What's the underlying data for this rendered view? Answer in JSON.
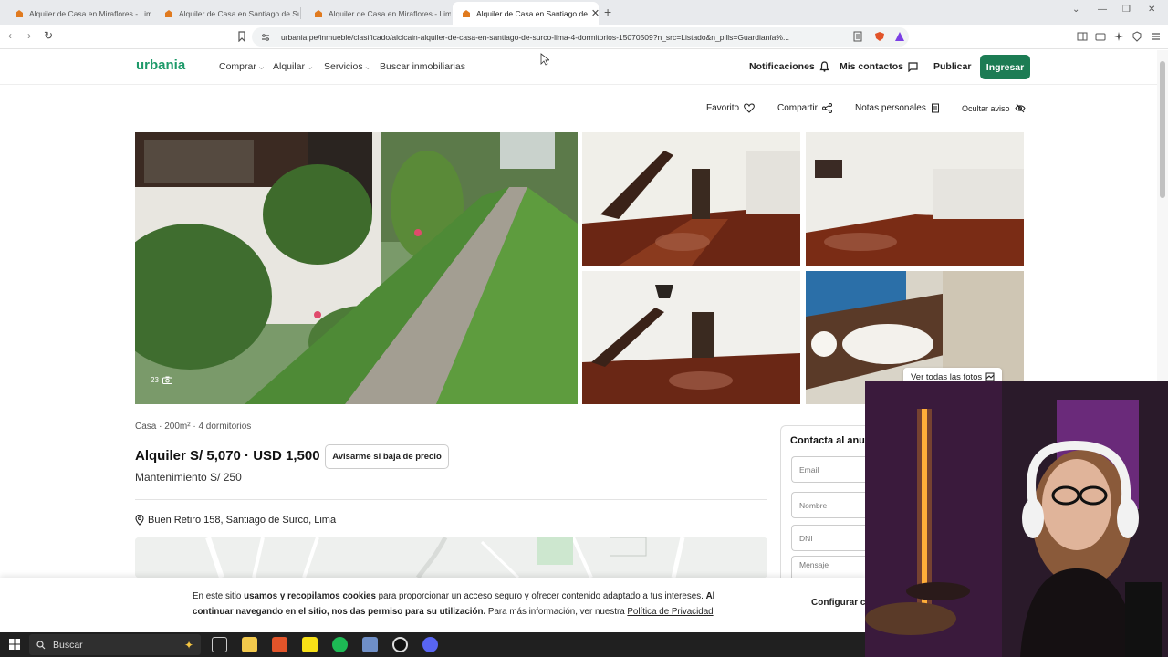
{
  "browser": {
    "tabs": [
      {
        "title": "Alquiler de Casa en Miraflores - Lima"
      },
      {
        "title": "Alquiler de Casa en Santiago de Surco"
      },
      {
        "title": "Alquiler de Casa en Miraflores - Lima"
      },
      {
        "title": "Alquiler de Casa en Santiago de"
      }
    ],
    "url": "urbania.pe/inmueble/clasificado/alclcain-alquiler-de-casa-en-santiago-de-surco-lima-4-dormitorios-15070509?n_src=Listado&n_pills=Guardianía%..."
  },
  "header": {
    "logo": "urbania",
    "menu": [
      "Comprar",
      "Alquilar",
      "Servicios",
      "Buscar inmobiliarias"
    ],
    "notifications": "Notificaciones",
    "contacts": "Mis contactos",
    "publish": "Publicar",
    "login": "Ingresar"
  },
  "actions": {
    "favorite": "Favorito",
    "share": "Compartir",
    "notes": "Notas personales",
    "hide": "Ocultar aviso"
  },
  "gallery": {
    "photo_count": "23",
    "view_all": "Ver todas las fotos"
  },
  "listing": {
    "meta": "Casa · 200m² · 4 dormitorios",
    "price": "Alquiler S/ 5,070 · USD 1,500",
    "price_alert": "Avisarme si baja de precio",
    "maintenance": "Mantenimiento S/ 250",
    "address": "Buen Retiro 158, Santiago de Surco, Lima"
  },
  "contact": {
    "title": "Contacta al anunciante",
    "email_placeholder": "Email",
    "name_placeholder": "Nombre",
    "dni_placeholder": "DNI",
    "message_placeholder": "Mensaje"
  },
  "cookie": {
    "t1": "En este sitio ",
    "b1": "usamos y recopilamos cookies",
    "t2": " para proporcionar un acceso seguro y ofrecer contenido adaptado a tus intereses. ",
    "b2": "Al continuar navegando en el sitio, nos das permiso para su utilización.",
    "t3": " Para más información, ver nuestra ",
    "link": "Política de Privacidad",
    "configure": "Configurar cookies"
  },
  "taskbar": {
    "search": "Buscar"
  },
  "colors": {
    "brand_green": "#1c7c54",
    "logo_green": "#1e9a6a"
  }
}
